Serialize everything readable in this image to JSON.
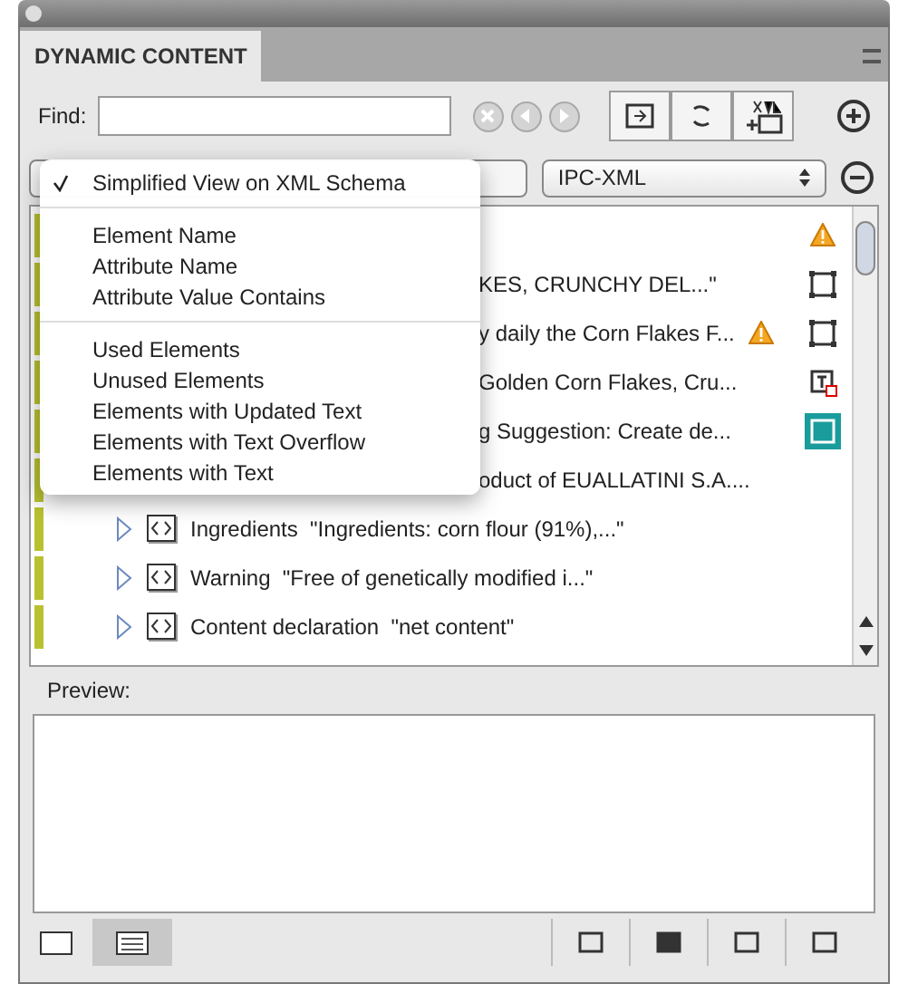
{
  "panel": {
    "tab": "DYNAMIC CONTENT"
  },
  "find": {
    "label": "Find:"
  },
  "dropdowns": [
    {
      "value": "IPC-XML"
    }
  ],
  "menu": [
    [
      {
        "label": "Simplified View on XML Schema",
        "checked": true
      }
    ],
    [
      {
        "label": "Element Name",
        "checked": false
      },
      {
        "label": "Attribute Name",
        "checked": false
      },
      {
        "label": "Attribute Value Contains",
        "checked": false
      }
    ],
    [
      {
        "label": "Used Elements",
        "checked": false
      },
      {
        "label": "Unused Elements",
        "checked": false
      },
      {
        "label": "Elements with Updated Text",
        "checked": false
      },
      {
        "label": "Elements with Text Overflow",
        "checked": false
      },
      {
        "label": "Elements with Text",
        "checked": false
      }
    ]
  ],
  "rows": [
    {
      "icons": [
        {
          "kind": "warning"
        }
      ]
    },
    {
      "text": "KES, CRUNCHY DEL...\"",
      "icons": [
        {
          "kind": "frame"
        }
      ]
    },
    {
      "text": "y daily the Corn Flakes F...",
      "icons": [
        {
          "kind": "warning"
        },
        {
          "kind": "frame"
        }
      ]
    },
    {
      "text": "Golden Corn Flakes, Cru...",
      "icons": [
        {
          "kind": "text-frame"
        }
      ]
    },
    {
      "text": "g Suggestion: Create de...",
      "icons": [
        {
          "kind": "frame-active"
        }
      ]
    },
    {
      "text": "oduct of EUALLATINI S.A...."
    },
    {
      "name": "Ingredients",
      "text": "\"Ingredients: corn flour (91%),...\""
    },
    {
      "name": "Warning",
      "text": "\"Free of genetically modified i...\""
    },
    {
      "name": "Content declaration",
      "text": "\"net content\""
    }
  ],
  "preview": {
    "label": "Preview:"
  }
}
